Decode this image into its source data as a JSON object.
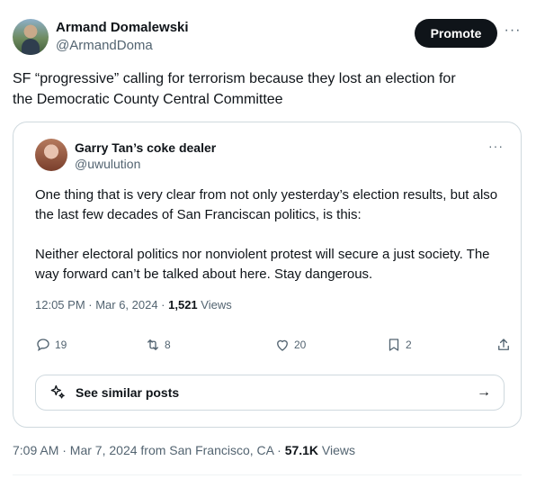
{
  "author": {
    "name": "Armand Domalewski",
    "handle": "@ArmandDoma"
  },
  "header": {
    "promote_label": "Promote",
    "more_label": "···"
  },
  "tweet": {
    "text_line1": "SF “progressive” calling for terrorism because they lost an election for",
    "text_line2": "the Democratic County Central Committee"
  },
  "quote": {
    "name": "Garry Tan’s coke dealer",
    "handle": "@uwulution",
    "more_label": "···",
    "paragraph1": "One thing that is very clear from not only yesterday’s election results, but also the last few decades of San Franciscan politics, is this:",
    "paragraph2": "Neither electoral politics nor nonviolent protest will secure a just society. The way forward can’t be talked about here. Stay dangerous.",
    "timestamp": "12:05 PM · Mar 6, 2024 · ",
    "views_count": "1,521",
    "views_label": " Views",
    "actions": {
      "replies": "19",
      "reposts": "8",
      "likes": "20",
      "bookmarks": "2"
    },
    "see_similar_label": "See similar posts",
    "see_similar_arrow": "→"
  },
  "post_meta": {
    "timestamp": "7:09 AM · Mar 7, 2024 from San Francisco, CA · ",
    "views_count": "57.1K",
    "views_label": " Views"
  },
  "colors": {
    "text_primary": "#0f1419",
    "text_secondary": "#536471",
    "border": "#cfd9de",
    "button_bg": "#0f1419"
  },
  "icons": [
    "reply-icon",
    "repost-icon",
    "like-icon",
    "bookmark-icon",
    "share-icon",
    "sparkle-icon",
    "arrow-right-icon"
  ]
}
